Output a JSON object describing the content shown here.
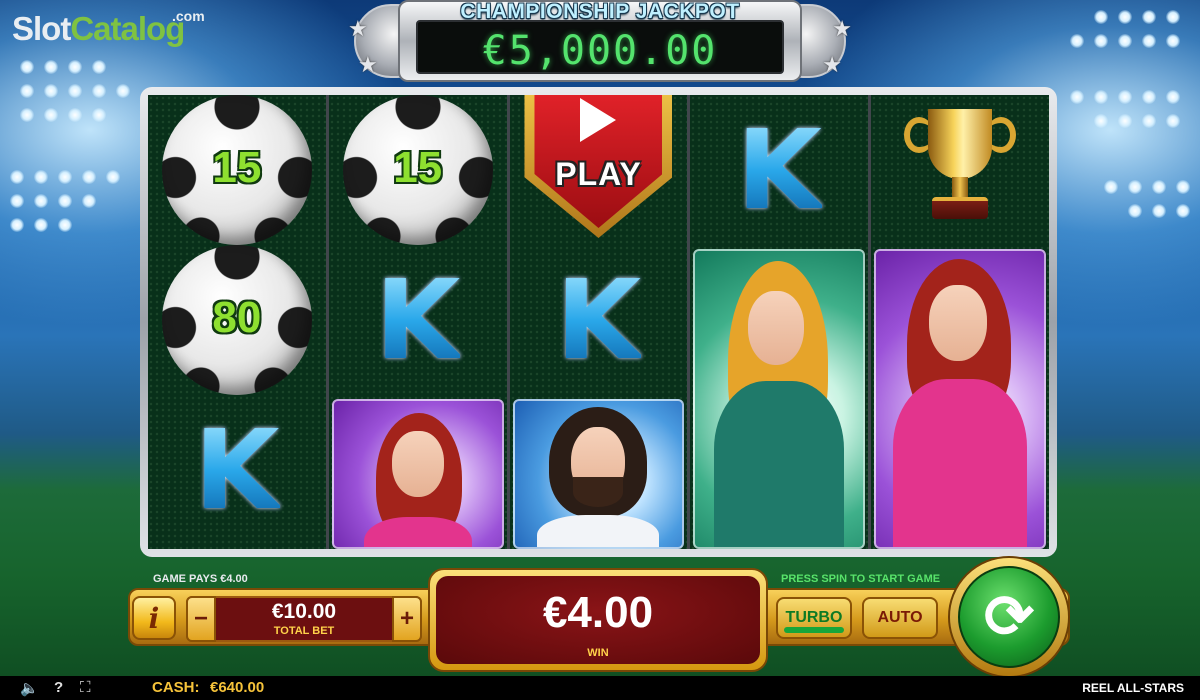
{
  "logo": {
    "slot": "Slot",
    "catalog": "Catalog",
    "com": ".com"
  },
  "jackpot": {
    "title": "CHAMPIONSHIP JACKPOT",
    "value": "€5,000.00"
  },
  "reels": {
    "col1": {
      "ball1": "15",
      "ball2": "80",
      "k": "K"
    },
    "col2": {
      "ball1": "15",
      "k": "K"
    },
    "col3": {
      "play": "PLAY",
      "k": "K"
    },
    "col4": {
      "k": "K"
    }
  },
  "messages": {
    "game_pays": "GAME PAYS €4.00",
    "press_spin": "PRESS SPIN TO START GAME"
  },
  "controls": {
    "info": "i",
    "minus": "−",
    "plus": "+",
    "bet_value": "€10.00",
    "bet_label": "TOTAL BET",
    "win_value": "€4.00",
    "win_label": "WIN",
    "turbo": "TURBO",
    "auto": "AUTO",
    "spin_glyph": "⟳"
  },
  "status": {
    "sound_icon": "🔈",
    "help_icon": "?",
    "fullscreen_icon": "⛶",
    "cash_label": "CASH:",
    "cash_value": "€640.00",
    "game_name": "REEL ALL-STARS"
  }
}
